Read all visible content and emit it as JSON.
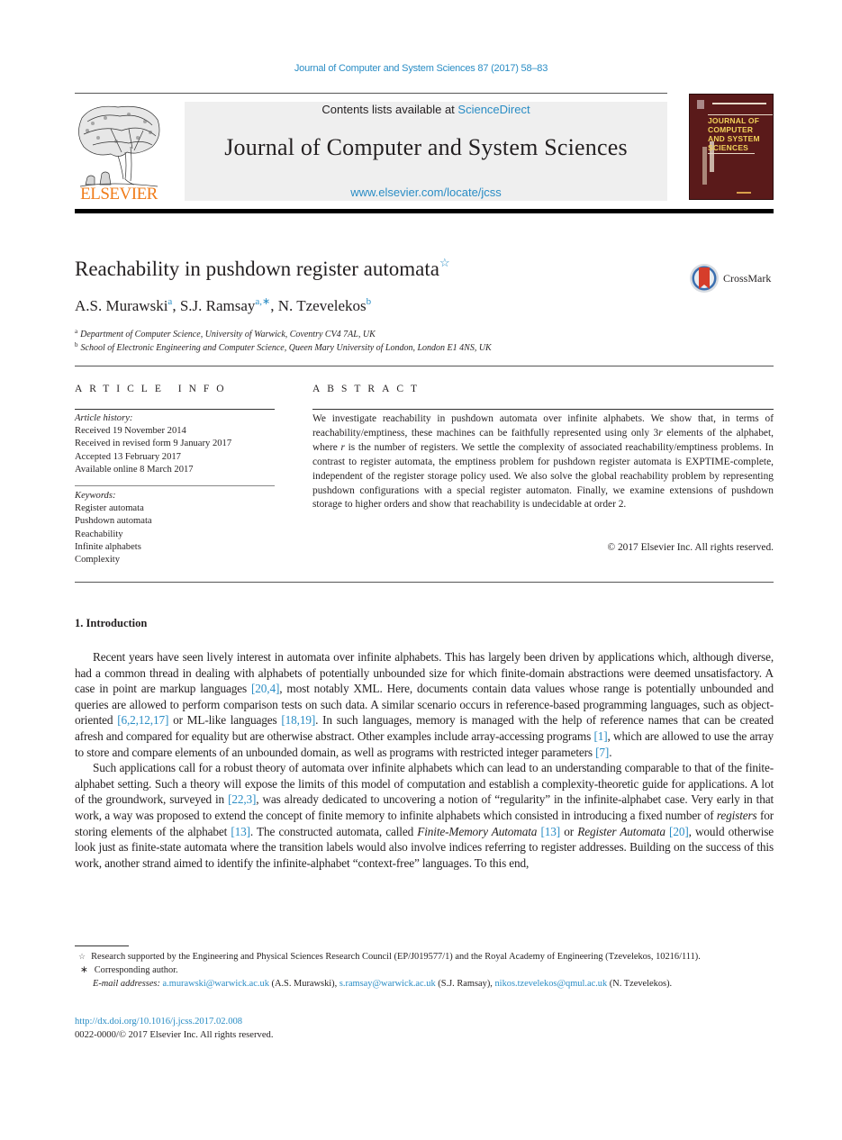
{
  "running_head": "Journal of Computer and System Sciences 87 (2017) 58–83",
  "publisher": {
    "name": "ELSEVIER",
    "color": "#f07c1a"
  },
  "banner": {
    "contents_prefix": "Contents lists available at ",
    "contents_link": "ScienceDirect",
    "journal_title": "Journal of Computer and System Sciences",
    "url": "www.elsevier.com/locate/jcss"
  },
  "cover": {
    "lines": [
      "JOURNAL OF",
      "COMPUTER",
      "AND SYSTEM",
      "SCIENCES"
    ]
  },
  "article": {
    "title": "Reachability in pushdown register automata",
    "title_mark": "☆",
    "crossmark_label": "CrossMark",
    "authors": [
      {
        "name": "A.S. Murawski",
        "sup": "a"
      },
      {
        "name": "S.J. Ramsay",
        "sup": "a,∗"
      },
      {
        "name": "N. Tzevelekos",
        "sup": "b"
      }
    ],
    "affiliations": [
      {
        "mark": "a",
        "text": "Department of Computer Science, University of Warwick, Coventry CV4 7AL, UK"
      },
      {
        "mark": "b",
        "text": "School of Electronic Engineering and Computer Science, Queen Mary University of London, London E1 4NS, UK"
      }
    ]
  },
  "article_info": {
    "heading": "ARTICLE INFO",
    "history_label": "Article history:",
    "history": [
      "Received 19 November 2014",
      "Received in revised form 9 January 2017",
      "Accepted 13 February 2017",
      "Available online 8 March 2017"
    ],
    "keywords_label": "Keywords:",
    "keywords": [
      "Register automata",
      "Pushdown automata",
      "Reachability",
      "Infinite alphabets",
      "Complexity"
    ]
  },
  "abstract": {
    "heading": "ABSTRACT",
    "text_1": "We investigate reachability in pushdown automata over infinite alphabets. We show that, in terms of reachability/emptiness, these machines can be faithfully represented using only 3",
    "text_r1": "r",
    "text_2": " elements of the alphabet, where ",
    "text_r2": "r",
    "text_3": " is the number of registers. We settle the complexity of associated reachability/emptiness problems. In contrast to register automata, the emptiness problem for pushdown register automata is EXPTIME-complete, independent of the register storage policy used. We also solve the global reachability problem by representing pushdown configurations with a special register automaton. Finally, we examine extensions of pushdown storage to higher orders and show that reachability is undecidable at order 2.",
    "copyright": "© 2017 Elsevier Inc. All rights reserved."
  },
  "introduction": {
    "heading": "1. Introduction",
    "p1": [
      "Recent years have seen lively interest in automata over infinite alphabets. This has largely been driven by applications which, although diverse, had a common thread in dealing with alphabets of potentially unbounded size for which finite-domain abstractions were deemed unsatisfactory. A case in point are markup languages ",
      "[20,4]",
      ", most notably XML. Here, documents contain data values whose range is potentially unbounded and queries are allowed to perform comparison tests on such data. A similar scenario occurs in reference-based programming languages, such as object-oriented ",
      "[6,2,12,17]",
      " or ML-like languages ",
      "[18,19]",
      ". In such languages, memory is managed with the help of reference names that can be created afresh and compared for equality but are otherwise abstract. Other examples include array-accessing programs ",
      "[1]",
      ", which are allowed to use the array to store and compare elements of an unbounded domain, as well as programs with restricted integer parameters ",
      "[7]",
      "."
    ],
    "p2": [
      "Such applications call for a robust theory of automata over infinite alphabets which can lead to an understanding comparable to that of the finite-alphabet setting. Such a theory will expose the limits of this model of computation and establish a complexity-theoretic guide for applications. A lot of the groundwork, surveyed in ",
      "[22,3]",
      ", was already dedicated to uncovering a notion of “regularity” in the infinite-alphabet case. Very early in that work, a way was proposed to extend the concept of finite memory to infinite alphabets which consisted in introducing a fixed number of ",
      "registers",
      " for storing elements of the alphabet ",
      "[13]",
      ". The constructed automata, called ",
      "Finite-Memory Automata",
      " ",
      "[13]",
      " or ",
      "Register Automata",
      " ",
      "[20]",
      ", would otherwise look just as finite-state automata where the transition labels would also involve indices referring to register addresses. Building on the success of this work, another strand aimed to identify the infinite-alphabet “context-free” languages. To this end,"
    ]
  },
  "footnotes": {
    "fn1_mark": "☆",
    "fn1": "Research supported by the Engineering and Physical Sciences Research Council (EP/J019577/1) and the Royal Academy of Engineering (Tzevelekos, 10216/111).",
    "fn2_mark": "∗",
    "fn2": "Corresponding author.",
    "email_label": "E-mail addresses:",
    "emails": [
      {
        "address": "a.murawski@warwick.ac.uk",
        "name": "(A.S. Murawski)"
      },
      {
        "address": "s.ramsay@warwick.ac.uk",
        "name": "(S.J. Ramsay)"
      },
      {
        "address": "nikos.tzevelekos@qmul.ac.uk",
        "name": "(N. Tzevelekos)."
      }
    ]
  },
  "doi": {
    "link": "http://dx.doi.org/10.1016/j.jcss.2017.02.008",
    "issn_line": "0022-0000/© 2017 Elsevier Inc. All rights reserved."
  },
  "colors": {
    "link": "#2a8dc5",
    "cover": "#5a1a1a",
    "cover_text": "#f2d25a",
    "elsevier_orange": "#f07c1a"
  }
}
